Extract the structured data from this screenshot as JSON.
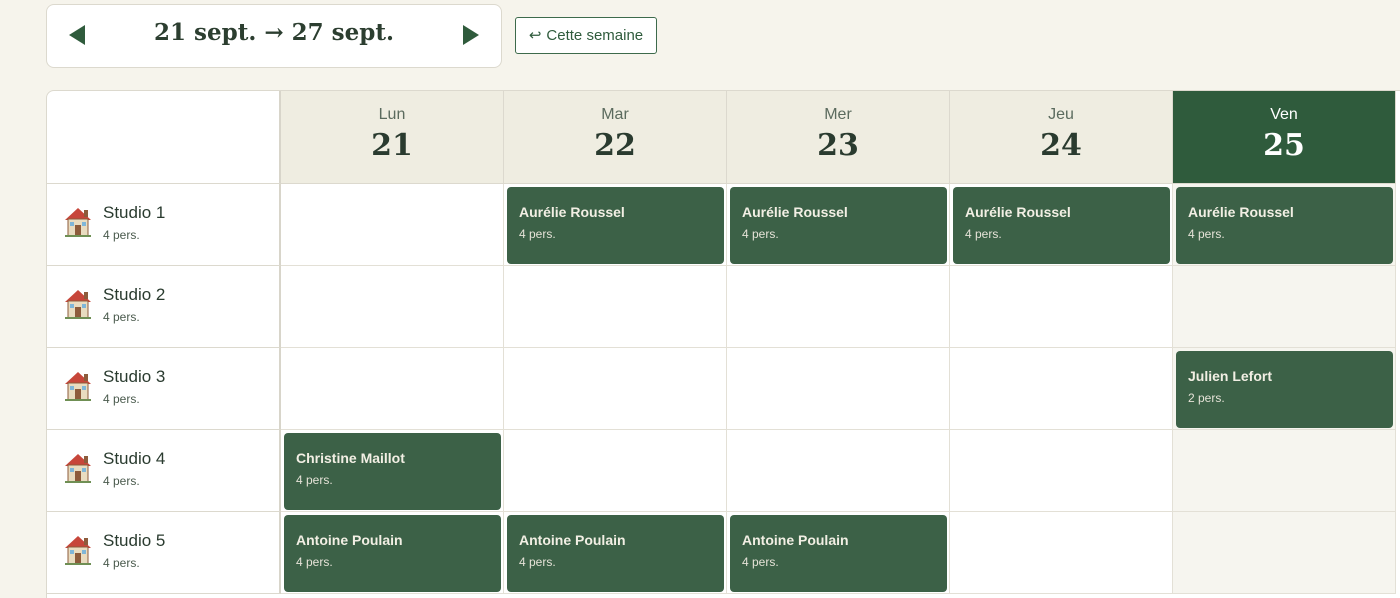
{
  "week_nav": {
    "range": "21 sept. → 27 sept."
  },
  "this_week": {
    "icon": "↩",
    "label": "Cette semaine"
  },
  "colors": {
    "accent": "#2f5b3c",
    "booking": "#3c6147",
    "header_bg": "#efede1",
    "page_bg": "#f6f4ec"
  },
  "days": [
    {
      "name": "Lun",
      "num": "21"
    },
    {
      "name": "Mar",
      "num": "22"
    },
    {
      "name": "Mer",
      "num": "23"
    },
    {
      "name": "Jeu",
      "num": "24"
    },
    {
      "name": "Ven",
      "num": "25",
      "today": true
    }
  ],
  "rooms": [
    {
      "name": "Studio 1",
      "capacity": "4 pers.",
      "icon": "house-icon"
    },
    {
      "name": "Studio 2",
      "capacity": "4 pers.",
      "icon": "house-icon"
    },
    {
      "name": "Studio 3",
      "capacity": "4 pers.",
      "icon": "house-icon"
    },
    {
      "name": "Studio 4",
      "capacity": "4 pers.",
      "icon": "house-icon"
    },
    {
      "name": "Studio 5",
      "capacity": "4 pers.",
      "icon": "house-icon"
    }
  ],
  "bookings": [
    {
      "room": 0,
      "day": 1,
      "guest": "Aurélie Roussel",
      "persons": "4 pers."
    },
    {
      "room": 0,
      "day": 2,
      "guest": "Aurélie Roussel",
      "persons": "4 pers."
    },
    {
      "room": 0,
      "day": 3,
      "guest": "Aurélie Roussel",
      "persons": "4 pers."
    },
    {
      "room": 0,
      "day": 4,
      "guest": "Aurélie Roussel",
      "persons": "4 pers."
    },
    {
      "room": 2,
      "day": 4,
      "guest": "Julien Lefort",
      "persons": "2 pers."
    },
    {
      "room": 3,
      "day": 0,
      "guest": "Christine Maillot",
      "persons": "4 pers."
    },
    {
      "room": 4,
      "day": 0,
      "guest": "Antoine Poulain",
      "persons": "4 pers."
    },
    {
      "room": 4,
      "day": 1,
      "guest": "Antoine Poulain",
      "persons": "4 pers."
    },
    {
      "room": 4,
      "day": 2,
      "guest": "Antoine Poulain",
      "persons": "4 pers."
    }
  ]
}
